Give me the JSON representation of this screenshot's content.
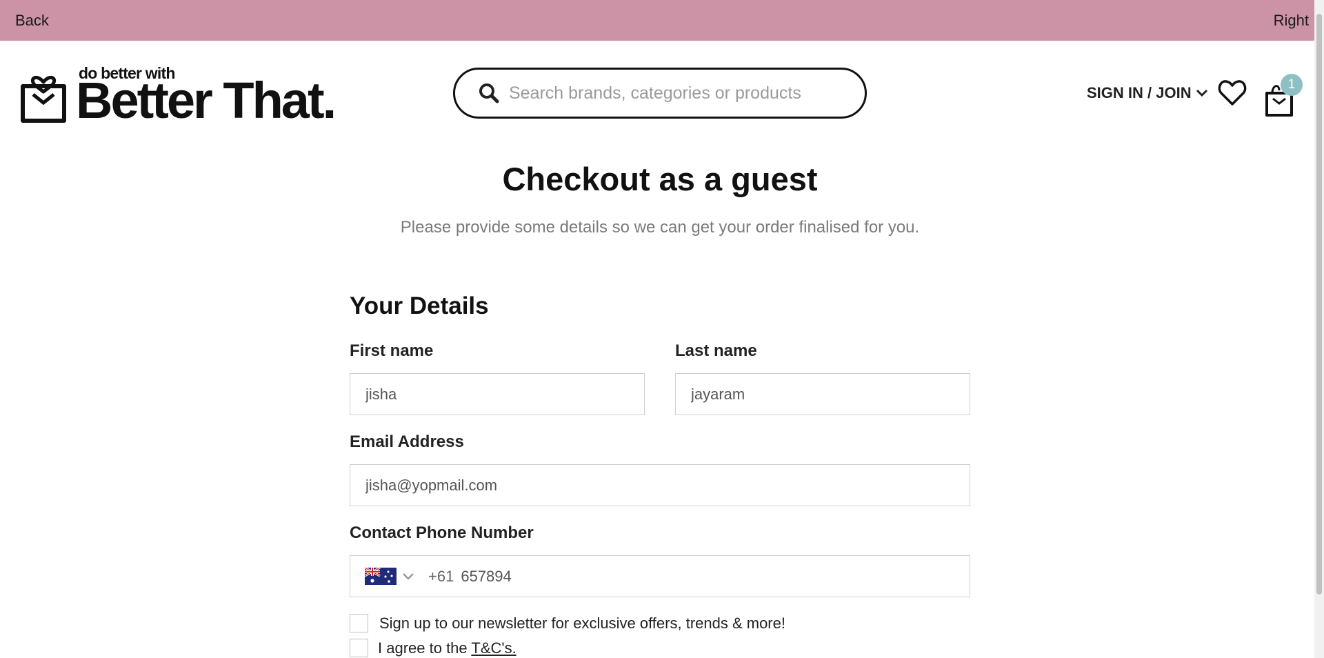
{
  "topbar": {
    "back_label": "Back",
    "right_label": "Right",
    "color": "#cc93a7"
  },
  "logo": {
    "small_text": "do better with",
    "big_text": "Better That."
  },
  "search": {
    "placeholder": "Search brands, categories or products",
    "icon": "search-icon"
  },
  "account": {
    "label": "SIGN IN / JOIN",
    "icon": "chevron-down-icon"
  },
  "wishlist": {
    "icon": "heart-icon"
  },
  "cart": {
    "icon": "shopping-bag-icon",
    "count": "1",
    "badge_color": "#8cc0c4"
  },
  "page": {
    "title": "Checkout as a guest",
    "subtitle": "Please provide some details so we can get your order finalised for you."
  },
  "form": {
    "section_title": "Your Details",
    "first_name": {
      "label": "First name",
      "value": "jisha"
    },
    "last_name": {
      "label": "Last name",
      "value": "jayaram"
    },
    "email": {
      "label": "Email Address",
      "value": "jisha@yopmail.com"
    },
    "phone": {
      "label": "Contact Phone Number",
      "country_icon": "australia-flag-icon",
      "prefix": "+61",
      "value": "657894"
    },
    "newsletter": {
      "label": "Sign up to our newsletter for exclusive offers, trends & more!",
      "checked": false
    },
    "terms": {
      "label_prefix": "I agree to the",
      "link_text": "T&C's.",
      "checked": false
    }
  }
}
